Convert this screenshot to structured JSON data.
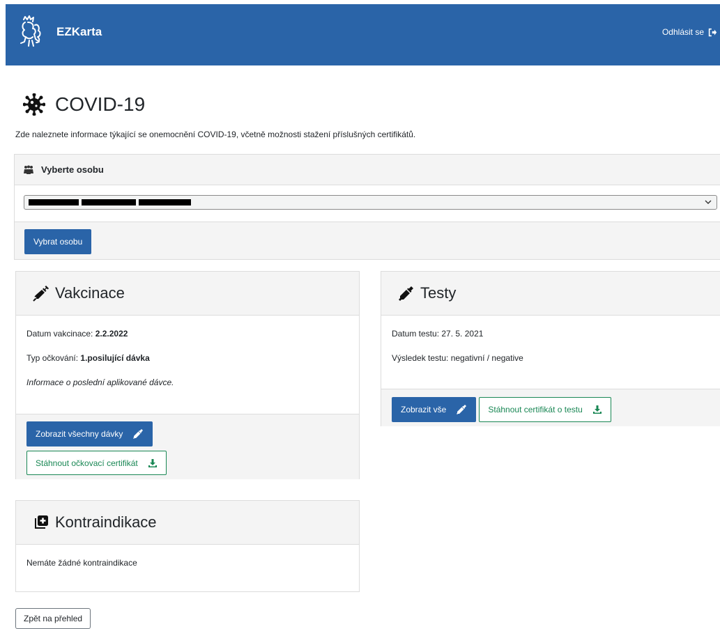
{
  "header": {
    "app_name": "EZKarta",
    "logout_label": "Odhlásit se",
    "logo_icon": "lion-coat-of-arms-icon",
    "logout_icon": "sign-out-icon"
  },
  "page": {
    "title": "COVID-19",
    "title_icon": "virus-icon",
    "intro": "Zde naleznete informace týkající se onemocnění COVID-19, včetně možnosti stažení příslušných certifikátů."
  },
  "person_select": {
    "header_label": "Vyberte osobu",
    "header_icon": "users-icon",
    "selected_value": "██████ ██████ ██████",
    "submit_label": "Vybrat osobu"
  },
  "vaccination": {
    "title": "Vakcinace",
    "icon": "syringe-icon",
    "date_label": "Datum vakcinace:",
    "date_value": "2.2.2022",
    "type_label": "Typ očkování:",
    "type_value": "1.posilující dávka",
    "note": "Informace o poslední aplikované dávce.",
    "show_all_label": "Zobrazit všechny dávky",
    "download_label": "Stáhnout očkovací certifikát"
  },
  "tests": {
    "title": "Testy",
    "icon": "eyedropper-icon",
    "date_text": "Datum testu: 27. 5. 2021",
    "result_text": "Výsledek testu: negativní / negative",
    "show_all_label": "Zobrazit vše",
    "download_label": "Stáhnout certifikát o testu"
  },
  "contraindications": {
    "title": "Kontraindikace",
    "icon": "notes-medical-icon",
    "text": "Nemáte žádné kontraindikace"
  },
  "back_label": "Zpět na přehled",
  "colors": {
    "brand": "#2a64a8",
    "success": "#198754",
    "panel_bg": "#f4f4f4"
  }
}
